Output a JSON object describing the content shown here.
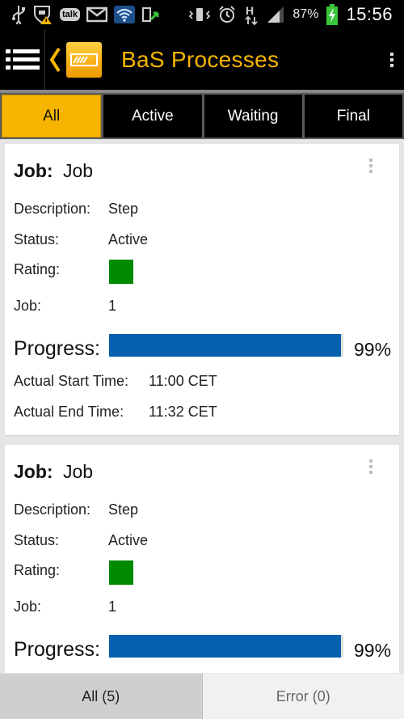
{
  "status_bar": {
    "icons": [
      "usb-icon",
      "warning-shield-icon",
      "talk-icon",
      "gmail-icon",
      "wifi-icon",
      "upload-icon",
      "vibrate-icon",
      "alarm-icon",
      "hspa-icon",
      "signal-icon",
      "battery-charging-icon"
    ],
    "talk_label": "talk",
    "hspa_label": "H",
    "battery_percent": "87%",
    "time": "15:56"
  },
  "action_bar": {
    "title": "BaS Processes",
    "accent_color": "#f7b500"
  },
  "tabs": [
    {
      "label": "All",
      "selected": true
    },
    {
      "label": "Active",
      "selected": false
    },
    {
      "label": "Waiting",
      "selected": false
    },
    {
      "label": "Final",
      "selected": false
    }
  ],
  "cards": [
    {
      "title_label": "Job:",
      "title_value": "Job",
      "description_label": "Description:",
      "description_value": "Step",
      "status_label": "Status:",
      "status_value": "Active",
      "rating_label": "Rating:",
      "rating_color": "#008a00",
      "job_label": "Job:",
      "job_value": "1",
      "progress_label": "Progress:",
      "progress_percent": 99,
      "progress_text": "99%",
      "start_label": "Actual Start Time:",
      "start_value": "11:00 CET",
      "end_label": "Actual End Time:",
      "end_value": "11:32 CET"
    },
    {
      "title_label": "Job:",
      "title_value": "Job",
      "description_label": "Description:",
      "description_value": "Step",
      "status_label": "Status:",
      "status_value": "Active",
      "rating_label": "Rating:",
      "rating_color": "#008a00",
      "job_label": "Job:",
      "job_value": "1",
      "progress_label": "Progress:",
      "progress_percent": 99,
      "progress_text": "99%"
    }
  ],
  "bottom_bar": {
    "all_label": "All (5)",
    "error_label": "Error (0)"
  }
}
